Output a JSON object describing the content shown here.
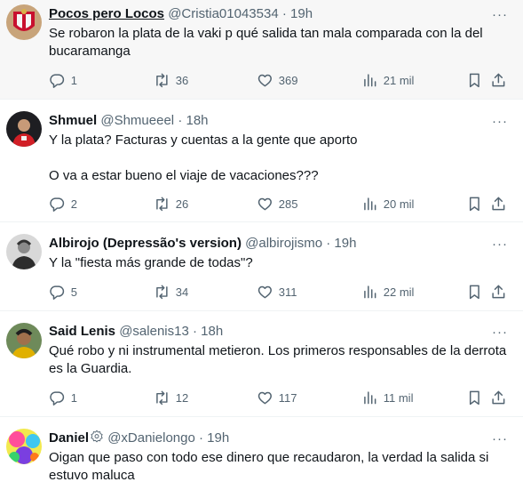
{
  "tweets": [
    {
      "name": "Pocos pero Locos",
      "handle": "@Cristia01043534",
      "dot": "·",
      "time": "19h",
      "more": "···",
      "text": [
        "Se robaron la plata de la vaki p qué salida tan mala comparada con la del bucaramanga"
      ],
      "stats": {
        "replies": "1",
        "retweets": "36",
        "likes": "369",
        "views": "21 mil"
      }
    },
    {
      "name": "Shmuel",
      "handle": "@Shmueeel",
      "dot": "·",
      "time": "18h",
      "more": "···",
      "text": [
        "Y la plata? Facturas y cuentas a la gente que aporto",
        "O va a estar bueno el viaje de vacaciones???"
      ],
      "stats": {
        "replies": "2",
        "retweets": "26",
        "likes": "285",
        "views": "20 mil"
      }
    },
    {
      "name": "Albirojo (Depressão's version)",
      "handle": "@albirojismo",
      "dot": "·",
      "time": "19h",
      "more": "···",
      "text": [
        "Y la \"fiesta más grande de todas\"?"
      ],
      "stats": {
        "replies": "5",
        "retweets": "34",
        "likes": "311",
        "views": "22 mil"
      }
    },
    {
      "name": "Said Lenis",
      "handle": "@salenis13",
      "dot": "·",
      "time": "18h",
      "more": "···",
      "text": [
        "Qué robo y ni instrumental metieron. Los primeros responsables de la derrota es la Guardia."
      ],
      "stats": {
        "replies": "1",
        "retweets": "12",
        "likes": "117",
        "views": "11 mil"
      }
    },
    {
      "name": "Daniel",
      "handle": "@xDanielongo",
      "dot": "·",
      "time": "19h",
      "more": "···",
      "text": [
        "Oigan que paso con todo ese dinero que recaudaron, la verdad la salida si estuvo maluca"
      ],
      "stats": {}
    }
  ],
  "colors": {
    "text": "#0f1419",
    "secondary": "#536471",
    "divider": "#eff3f4",
    "highlight_bg": "#f7f7f7"
  },
  "icons": [
    "reply-icon",
    "retweet-icon",
    "like-icon",
    "views-icon",
    "bookmark-icon",
    "share-icon",
    "verified-badge-icon"
  ]
}
